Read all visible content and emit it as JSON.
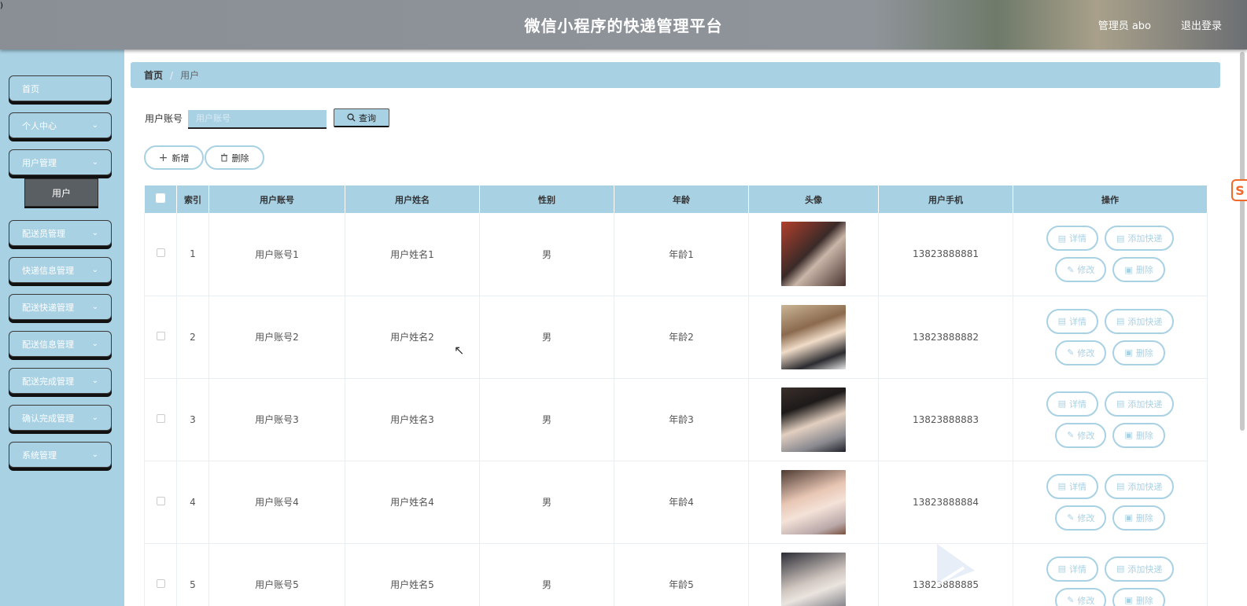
{
  "header": {
    "corner_glyph": ")",
    "title": "微信小程序的快递管理平台",
    "user": "管理员 abo",
    "logout": "退出登录"
  },
  "sidebar": {
    "items": [
      {
        "label": "首页",
        "has_chevron": false
      },
      {
        "label": "个人中心",
        "has_chevron": true
      },
      {
        "label": "用户管理",
        "has_chevron": true
      },
      {
        "label": "配送员管理",
        "has_chevron": true
      },
      {
        "label": "快递信息管理",
        "has_chevron": true
      },
      {
        "label": "配送快递管理",
        "has_chevron": true
      },
      {
        "label": "配送信息管理",
        "has_chevron": true
      },
      {
        "label": "配送完成管理",
        "has_chevron": true
      },
      {
        "label": "确认完成管理",
        "has_chevron": true
      },
      {
        "label": "系统管理",
        "has_chevron": true
      }
    ],
    "active_sub": "用户"
  },
  "breadcrumb": {
    "home": "首页",
    "separator": "/",
    "current": "用户"
  },
  "search": {
    "label": "用户账号",
    "placeholder": "用户账号",
    "value": "",
    "button": "查询"
  },
  "actions": {
    "add": "新增",
    "delete": "删除"
  },
  "table": {
    "headers": [
      "索引",
      "用户账号",
      "用户姓名",
      "性别",
      "年龄",
      "头像",
      "用户手机",
      "操作"
    ],
    "rows": [
      {
        "index": "1",
        "account": "用户账号1",
        "name": "用户姓名1",
        "gender": "男",
        "age": "年龄1",
        "phone": "13823888881"
      },
      {
        "index": "2",
        "account": "用户账号2",
        "name": "用户姓名2",
        "gender": "男",
        "age": "年龄2",
        "phone": "13823888882"
      },
      {
        "index": "3",
        "account": "用户账号3",
        "name": "用户姓名3",
        "gender": "男",
        "age": "年龄3",
        "phone": "13823888883"
      },
      {
        "index": "4",
        "account": "用户账号4",
        "name": "用户姓名4",
        "gender": "男",
        "age": "年龄4",
        "phone": "13823888884"
      },
      {
        "index": "5",
        "account": "用户账号5",
        "name": "用户姓名5",
        "gender": "男",
        "age": "年龄5",
        "phone": "13823888885"
      }
    ],
    "row_ops": {
      "detail": "详情",
      "add_express": "添加快递",
      "edit": "修改",
      "delete": "删除"
    }
  },
  "side_mark": "S",
  "colors": {
    "accent": "#a9d1e4",
    "header": "#8f949a",
    "sub_active": "#5a5f63",
    "brand_mark": "#f06a2a"
  }
}
